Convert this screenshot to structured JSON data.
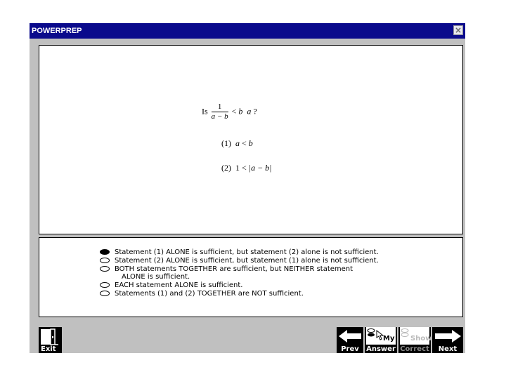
{
  "window": {
    "title": "POWERPREP",
    "close_glyph": "×"
  },
  "question": {
    "stem_prefix": "Is",
    "frac_num": "1",
    "frac_den": "a − b",
    "stem_suffix_op": "<",
    "stem_var_b": "b",
    "stem_var_a": "a",
    "stem_end": "?",
    "s1_num": "(1)",
    "s1_a": "a",
    "s1_op": "<",
    "s1_b": "b",
    "s2_num": "(2)",
    "s2_lhs": "1",
    "s2_op": "<",
    "s2_abs": "|a − b|"
  },
  "answers": {
    "selected_index": 0,
    "choices": [
      {
        "text": "Statement (1) ALONE is sufficient, but statement (2) alone is not sufficient."
      },
      {
        "text": "Statement (2) ALONE is sufficient, but statement (1) alone is not sufficient."
      },
      {
        "text": "BOTH statements TOGETHER are sufficient, but NEITHER statement",
        "text2": "ALONE is sufficient."
      },
      {
        "text": "EACH statement ALONE is sufficient."
      },
      {
        "text": "Statements (1) and (2) TOGETHER are NOT sufficient."
      }
    ]
  },
  "toolbar": {
    "exit_label": "Exit",
    "prev_label": "Prev",
    "my_label": "My",
    "answer_label": "Answer",
    "show_label": "Show",
    "correct_label": "Correct",
    "next_label": "Next"
  },
  "icons": {
    "exit": "door-exit-icon",
    "prev": "arrow-left-icon",
    "my_answer": "pointer-hand-icon",
    "show_correct": "light-bulb-icon",
    "next": "arrow-right-icon"
  }
}
